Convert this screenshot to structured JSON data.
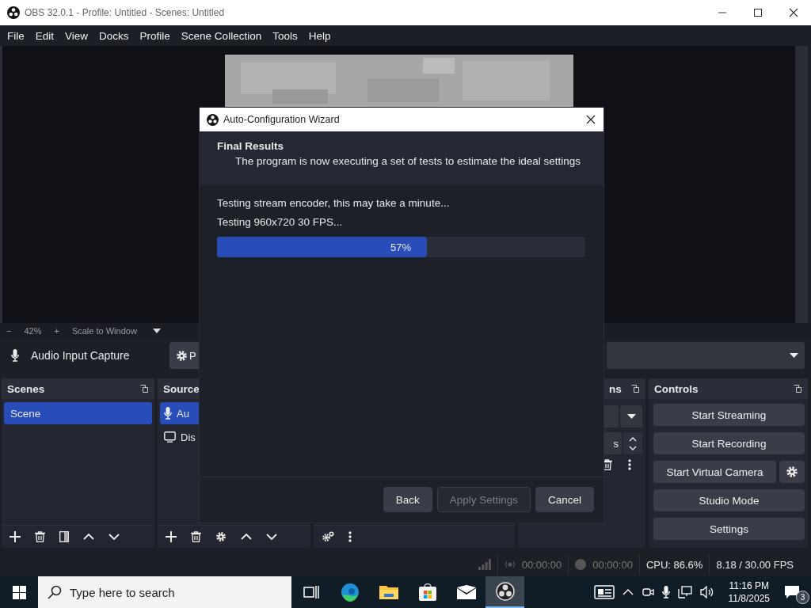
{
  "window": {
    "title": "OBS 32.0.1 - Profile: Untitled - Scenes: Untitled"
  },
  "menu": [
    "File",
    "Edit",
    "View",
    "Docks",
    "Profile",
    "Scene Collection",
    "Tools",
    "Help"
  ],
  "zoom_bar": {
    "zoom_out": "−",
    "zoom": "42%",
    "zoom_in": "+",
    "scale": "Scale to Window"
  },
  "source_toolbar": {
    "source": "Audio Input Capture",
    "properties_button": "P"
  },
  "scenes": {
    "title": "Scenes",
    "items": [
      {
        "label": "Scene",
        "selected": true
      }
    ]
  },
  "sources": {
    "title": "Source",
    "items": [
      {
        "label": "Au",
        "kind": "mic",
        "selected": true
      },
      {
        "label": "Dis",
        "kind": "display",
        "selected": false
      }
    ]
  },
  "transitions": {
    "title": "ns",
    "duration": "s"
  },
  "controls": {
    "title": "Controls",
    "buttons": [
      {
        "label": "Start Streaming",
        "kind": "plain"
      },
      {
        "label": "Start Recording",
        "kind": "plain"
      },
      {
        "label": "Start Virtual Camera",
        "kind": "with_settings"
      },
      {
        "label": "Studio Mode",
        "kind": "plain"
      },
      {
        "label": "Settings",
        "kind": "plain"
      }
    ]
  },
  "status_bar": {
    "stream_time": "00:00:00",
    "record_time": "00:00:00",
    "cpu": "CPU: 86.6%",
    "fps": "8.18 / 30.00 FPS"
  },
  "dialog": {
    "title": "Auto-Configuration Wizard",
    "heading": "Final Results",
    "description": "The program is now executing a set of tests to estimate the ideal settings",
    "status": "Testing stream encoder, this may take a minute...",
    "substatus": "Testing 960x720 30 FPS...",
    "progress": {
      "level": 0.57,
      "reading": "57%"
    },
    "buttons": [
      {
        "label": "Back",
        "disabled": false
      },
      {
        "label": "Apply Settings",
        "disabled": true
      },
      {
        "label": "Cancel",
        "disabled": false
      }
    ]
  },
  "taskbar": {
    "search": {
      "placeholder": "Type here to search"
    },
    "apps": [
      {
        "kind": "taskview",
        "active": false
      },
      {
        "kind": "edge",
        "active": false
      },
      {
        "kind": "explorer",
        "active": false
      },
      {
        "kind": "store",
        "active": false
      },
      {
        "kind": "mail",
        "active": false
      },
      {
        "kind": "obs",
        "active": true
      }
    ],
    "time": "11:16 PM",
    "date": "11/8/2025",
    "notifications": "3"
  }
}
